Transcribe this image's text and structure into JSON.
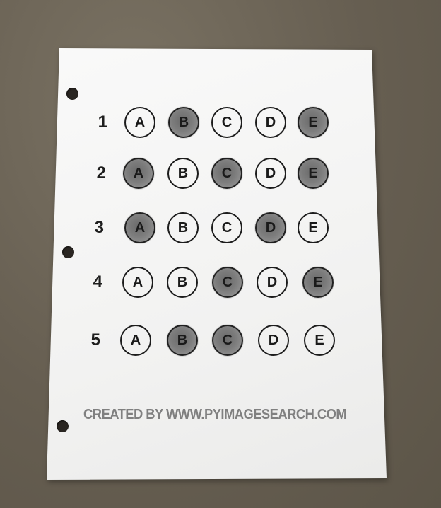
{
  "questions": [
    {
      "number": "1",
      "choices": [
        "A",
        "B",
        "C",
        "D",
        "E"
      ],
      "marked": [
        "B",
        "E"
      ]
    },
    {
      "number": "2",
      "choices": [
        "A",
        "B",
        "C",
        "D",
        "E"
      ],
      "marked": [
        "A",
        "C",
        "E"
      ]
    },
    {
      "number": "3",
      "choices": [
        "A",
        "B",
        "C",
        "D",
        "E"
      ],
      "marked": [
        "A",
        "D"
      ]
    },
    {
      "number": "4",
      "choices": [
        "A",
        "B",
        "C",
        "D",
        "E"
      ],
      "marked": [
        "C",
        "E"
      ]
    },
    {
      "number": "5",
      "choices": [
        "A",
        "B",
        "C",
        "D",
        "E"
      ],
      "marked": [
        "B",
        "C"
      ]
    }
  ],
  "footer_text": "CREATED BY WWW.PYIMAGESEARCH.COM",
  "colors": {
    "background": "#6b6356",
    "paper": "#f4f4f3",
    "ink": "#1c1c1c",
    "fill": "#7c7c7c",
    "footer": "#808080"
  }
}
